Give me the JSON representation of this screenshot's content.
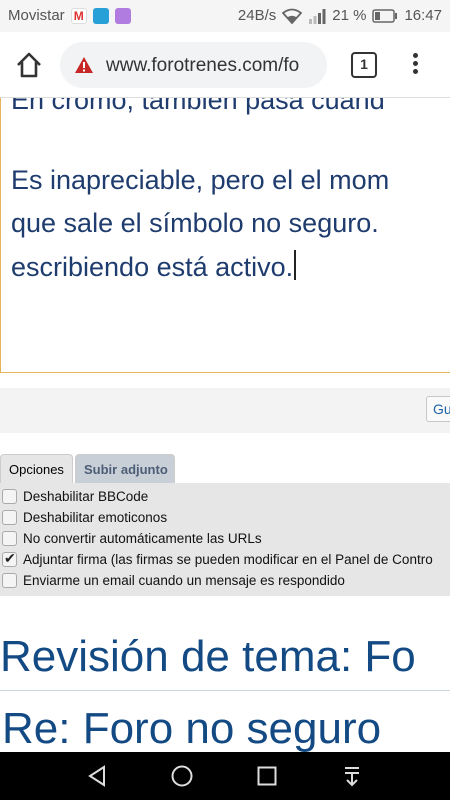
{
  "status_bar": {
    "carrier": "Movistar",
    "data_rate": "24B/s",
    "battery_percent": "21 %",
    "time": "16:47"
  },
  "browser": {
    "url": "www.forotrenes.com/fo",
    "tab_count": "1",
    "security_state": "not-secure-warning"
  },
  "editor": {
    "lines": [
      "En cromo, también pasa cuand",
      "",
      "Es inapreciable, pero el el mom",
      "que sale el símbolo no seguro.",
      "escribiendo está activo."
    ]
  },
  "form": {
    "partial_button_label": "Gu"
  },
  "tabs": [
    {
      "label": "Opciones",
      "active": true
    },
    {
      "label": "Subir adjunto",
      "active": false
    }
  ],
  "options": [
    {
      "label": "Deshabilitar BBCode",
      "checked": false
    },
    {
      "label": "Deshabilitar emoticonos",
      "checked": false
    },
    {
      "label": "No convertir automáticamente las URLs",
      "checked": false
    },
    {
      "label": "Adjuntar firma (las firmas se pueden modificar en el Panel de Contro",
      "checked": true
    },
    {
      "label": "Enviarme un email cuando un mensaje es respondido",
      "checked": false
    }
  ],
  "headings": {
    "revision": "Revisión de tema: Fo",
    "reply": "Re: Foro no seguro"
  },
  "colors": {
    "heading": "#134a84",
    "editor_text": "#1f3c6e",
    "editor_border": "#e8b25a",
    "link": "#1e63a8"
  },
  "icons": {
    "home": "home-icon",
    "warning": "warning-icon",
    "menu": "kebab-menu-icon",
    "back": "back-icon",
    "home_nav": "circle-home-icon",
    "recents": "square-recents-icon",
    "notifications": "notification-pull-icon"
  }
}
